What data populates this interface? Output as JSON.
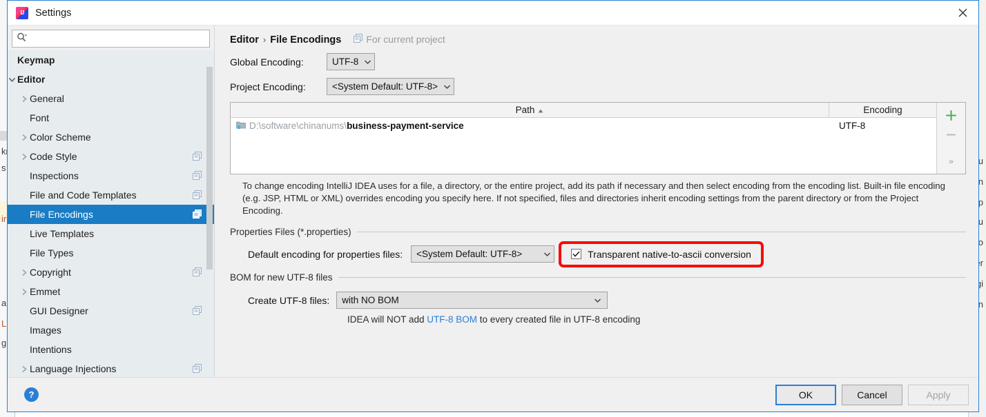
{
  "window": {
    "title": "Settings",
    "logo_icon": "intellij-idea-logo",
    "close_icon": "close-icon"
  },
  "search": {
    "value": "",
    "placeholder": "",
    "icon": "search-icon"
  },
  "sidebar": {
    "scroll": {
      "thumb_top_pct": 5,
      "thumb_height_pct": 62
    },
    "items": [
      {
        "label": "Keymap",
        "indent": 14,
        "arrow": "none",
        "bold": true,
        "badge": false,
        "selected": false
      },
      {
        "label": "Editor",
        "indent": 14,
        "arrow": "down",
        "bold": true,
        "badge": false,
        "selected": false
      },
      {
        "label": "General",
        "indent": 32,
        "arrow": "right",
        "bold": false,
        "badge": false,
        "selected": false
      },
      {
        "label": "Font",
        "indent": 32,
        "arrow": "none",
        "bold": false,
        "badge": false,
        "selected": false
      },
      {
        "label": "Color Scheme",
        "indent": 32,
        "arrow": "right",
        "bold": false,
        "badge": false,
        "selected": false
      },
      {
        "label": "Code Style",
        "indent": 32,
        "arrow": "right",
        "bold": false,
        "badge": true,
        "selected": false
      },
      {
        "label": "Inspections",
        "indent": 32,
        "arrow": "none",
        "bold": false,
        "badge": true,
        "selected": false
      },
      {
        "label": "File and Code Templates",
        "indent": 32,
        "arrow": "none",
        "bold": false,
        "badge": true,
        "selected": false
      },
      {
        "label": "File Encodings",
        "indent": 32,
        "arrow": "none",
        "bold": false,
        "badge": true,
        "selected": true
      },
      {
        "label": "Live Templates",
        "indent": 32,
        "arrow": "none",
        "bold": false,
        "badge": false,
        "selected": false
      },
      {
        "label": "File Types",
        "indent": 32,
        "arrow": "none",
        "bold": false,
        "badge": false,
        "selected": false
      },
      {
        "label": "Copyright",
        "indent": 32,
        "arrow": "right",
        "bold": false,
        "badge": true,
        "selected": false
      },
      {
        "label": "Emmet",
        "indent": 32,
        "arrow": "right",
        "bold": false,
        "badge": false,
        "selected": false
      },
      {
        "label": "GUI Designer",
        "indent": 32,
        "arrow": "none",
        "bold": false,
        "badge": true,
        "selected": false
      },
      {
        "label": "Images",
        "indent": 32,
        "arrow": "none",
        "bold": false,
        "badge": false,
        "selected": false
      },
      {
        "label": "Intentions",
        "indent": 32,
        "arrow": "none",
        "bold": false,
        "badge": false,
        "selected": false
      },
      {
        "label": "Language Injections",
        "indent": 32,
        "arrow": "right",
        "bold": false,
        "badge": true,
        "selected": false
      }
    ]
  },
  "breadcrumb": {
    "parent": "Editor",
    "separator": "›",
    "current": "File Encodings",
    "scope_note": "For current project",
    "scope_icon": "copy-badge-icon"
  },
  "global_encoding": {
    "label": "Global Encoding:",
    "value": "UTF-8"
  },
  "project_encoding": {
    "label": "Project Encoding:",
    "value": "<System Default: UTF-8>"
  },
  "table": {
    "columns": [
      "Path",
      "Encoding"
    ],
    "sort_column": "Path",
    "sort_caret": "▲",
    "rows": [
      {
        "icon": "folder-icon",
        "path_prefix": "D:\\software\\chinanums\\",
        "path_name": "business-payment-service",
        "encoding": "UTF-8"
      }
    ],
    "add_button": "+",
    "remove_button": "−",
    "expand_button": "»"
  },
  "description": "To change encoding IntelliJ IDEA uses for a file, a directory, or the entire project, add its path if necessary and then select encoding from the encoding list. Built-in file encoding (e.g. JSP, HTML or XML) overrides encoding you specify here. If not specified, files and directories inherit encoding settings from the parent directory or from the Project Encoding.",
  "properties_section": {
    "title": "Properties Files (*.properties)",
    "encoding_label": "Default encoding for properties files:",
    "encoding_value": "<System Default: UTF-8>",
    "checkbox_label": "Transparent native-to-ascii conversion",
    "checkbox_checked": true,
    "highlight_color": "#fb0a0a"
  },
  "bom_section": {
    "title": "BOM for new UTF-8 files",
    "create_label": "Create UTF-8 files:",
    "create_value": "with NO BOM",
    "hint_before": "IDEA will NOT add ",
    "hint_link": "UTF-8 BOM",
    "hint_after": " to every created file in UTF-8 encoding"
  },
  "footer": {
    "help_icon": "help-icon",
    "help_glyph": "?",
    "ok": "OK",
    "cancel": "Cancel",
    "apply": "Apply",
    "apply_disabled": true
  },
  "colors": {
    "selection_blue": "#1a7cc4",
    "accent_blue": "#2a7fd4",
    "annotation_red": "#fb0a0a",
    "sidebar_bg": "#e7ecef",
    "panel_bg": "#f0f0f0"
  },
  "background_fragments": {
    "left": [
      "kr",
      "s",
      "ir",
      "ar",
      "L(",
      "g"
    ],
    "right": [
      "u",
      "n",
      "p",
      "lu",
      "o",
      "er",
      "gi",
      "n"
    ]
  }
}
